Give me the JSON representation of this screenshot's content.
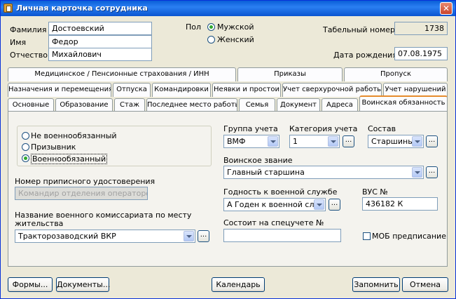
{
  "window": {
    "title": "Личная карточка сотрудника",
    "close_glyph": "✕"
  },
  "person": {
    "surname_label": "Фамилия",
    "surname": "Достоевский",
    "name_label": "Имя",
    "name": "Федор",
    "patronymic_label": "Отчество",
    "patronymic": "Михайлович",
    "gender_label": "Пол",
    "gender_male": "Мужской",
    "gender_female": "Женский",
    "gender_selected": "male",
    "tabnum_label": "Табельный номер",
    "tabnum": "1738",
    "birth_label": "Дата рождения",
    "birth": "07.08.1975"
  },
  "tabs": {
    "row1": [
      "Медицинское / Пенсионные страхования / ИНН",
      "Приказы",
      "Пропуск"
    ],
    "row2": [
      "Назначения и перемещения",
      "Отпуска",
      "Командировки",
      "Неявки и простои",
      "Учет сверхурочной работы",
      "Учет нарушений"
    ],
    "row3": [
      "Основные",
      "Образование",
      "Стаж",
      "Последнее место работы",
      "Семья",
      "Документ",
      "Адреса",
      "Воинская обязанность"
    ],
    "active": "Воинская обязанность"
  },
  "military": {
    "status_options": [
      "Не военнообязанный",
      "Призывник",
      "Военнообязанный"
    ],
    "status_selected": 2,
    "cert_label": "Номер приписного удостоверения",
    "cert_value": "Командир отделения операторов",
    "commissariat_label": "Название военного комиссариата по месту жительства",
    "commissariat_value": "Тракторозаводский ВКР",
    "group_label": "Группа учета",
    "group_value": "ВМФ",
    "category_label": "Категория учета",
    "category_value": "1",
    "composition_label": "Состав",
    "composition_value": "Старшины",
    "rank_label": "Воинское звание",
    "rank_value": "Главный старшина",
    "fitness_label": "Годность к военной службе",
    "fitness_value": "А  Годен к военной служб",
    "vus_label": "ВУС №",
    "vus_value": "436182 К",
    "special_label": "Состоит на спецучете №",
    "special_value": "",
    "mob_label": "МОБ предписание"
  },
  "buttons": {
    "forms": "Формы...",
    "documents": "Документы...",
    "calendar": "Календарь",
    "save": "Запомнить",
    "cancel": "Отмена",
    "dots": "..."
  }
}
